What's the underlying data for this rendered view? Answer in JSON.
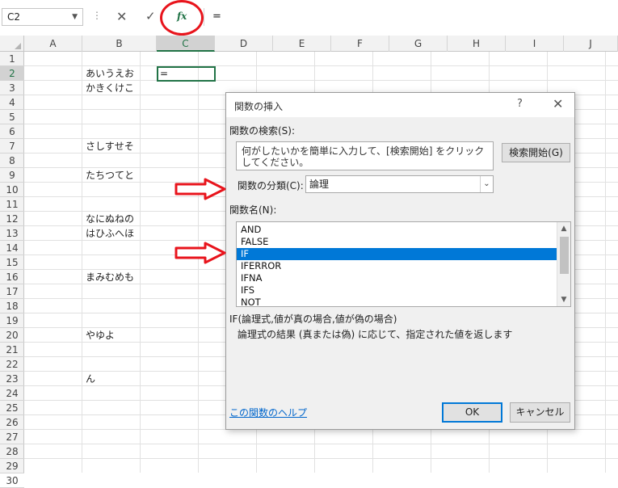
{
  "formula_bar": {
    "name_box": "C2",
    "formula": "="
  },
  "columns": [
    "A",
    "B",
    "C",
    "D",
    "E",
    "F",
    "G",
    "H",
    "I",
    "J"
  ],
  "selected_column": "C",
  "rows": [
    "1",
    "2",
    "3",
    "4",
    "5",
    "6",
    "7",
    "8",
    "9",
    "10",
    "11",
    "12",
    "13",
    "14",
    "15",
    "16",
    "17",
    "18",
    "19",
    "20",
    "21",
    "22",
    "23",
    "24",
    "25",
    "26",
    "27",
    "28",
    "29",
    "30"
  ],
  "selected_row": "2",
  "cells": {
    "B2": "あいうえお",
    "C2": "=",
    "B3": "かきくけこ",
    "B7": "さしすせそ",
    "B9": "たちつてと",
    "B12": "なにぬねの",
    "B13": "はひふへほ",
    "B16": "まみむめも",
    "B20": "やゆよ",
    "B23": "ん"
  },
  "dialog": {
    "title": "関数の挿入",
    "help_icon": "?",
    "close_icon": "✕",
    "search_label": "関数の検索(S):",
    "search_text": "何がしたいかを簡単に入力して、[検索開始] をクリックしてください。",
    "search_button": "検索開始(G)",
    "category_label": "関数の分類(C):",
    "category_value": "論理",
    "function_list_label": "関数名(N):",
    "functions": [
      "AND",
      "FALSE",
      "IF",
      "IFERROR",
      "IFNA",
      "IFS",
      "NOT"
    ],
    "selected_function": "IF",
    "syntax": "IF(論理式,値が真の場合,値が偽の場合)",
    "description": "論理式の結果 (真または偽) に応じて、指定された値を返します",
    "help_link": "この関数のヘルプ",
    "ok_button": "OK",
    "cancel_button": "キャンセル"
  },
  "annotation_colors": {
    "circle": "#e8141c",
    "arrow": "#e8141c"
  }
}
